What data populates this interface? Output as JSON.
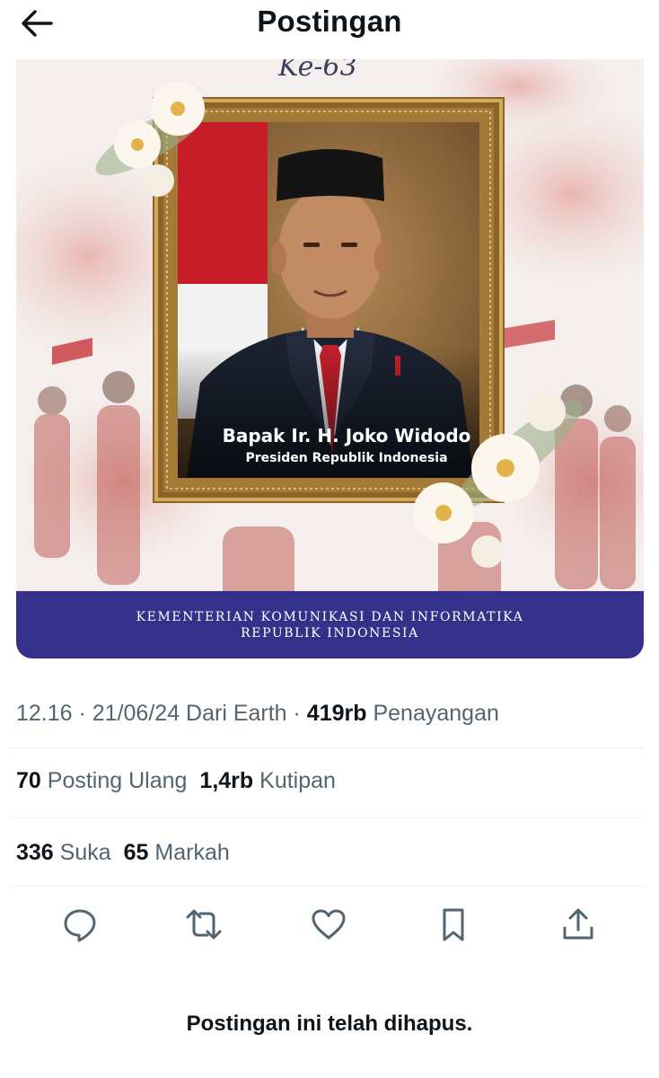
{
  "header": {
    "title": "Postingan",
    "back_icon": "arrow-left-icon"
  },
  "media": {
    "frame_heading": "Ke-63",
    "person_name": "Bapak Ir. H. Joko Widodo",
    "person_title": "Presiden Republik Indonesia",
    "banner_line1": "KEMENTERIAN KOMUNIKASI DAN INFORMATIKA",
    "banner_line2": "REPUBLIK INDONESIA",
    "colors": {
      "banner": "#33318a",
      "frame": "#a97e3a",
      "flag_red": "#c81e2a"
    }
  },
  "meta": {
    "timestamp": "12.16 · 21/06/24 Dari Earth · ",
    "views_count": "419rb",
    "views_label": "Penayangan"
  },
  "stats": {
    "reposts_count": "70",
    "reposts_label": "Posting Ulang",
    "quotes_count": "1,4rb",
    "quotes_label": "Kutipan",
    "likes_count": "336",
    "likes_label": "Suka",
    "bookmarks_count": "65",
    "bookmarks_label": "Markah"
  },
  "actions": [
    "reply-icon",
    "repost-icon",
    "like-icon",
    "bookmark-icon",
    "share-icon"
  ],
  "footer": {
    "deleted_notice": "Postingan ini telah dihapus."
  },
  "colors": {
    "secondary_text": "#536471",
    "primary_text": "#0f1419",
    "divider": "#eff3f4"
  }
}
